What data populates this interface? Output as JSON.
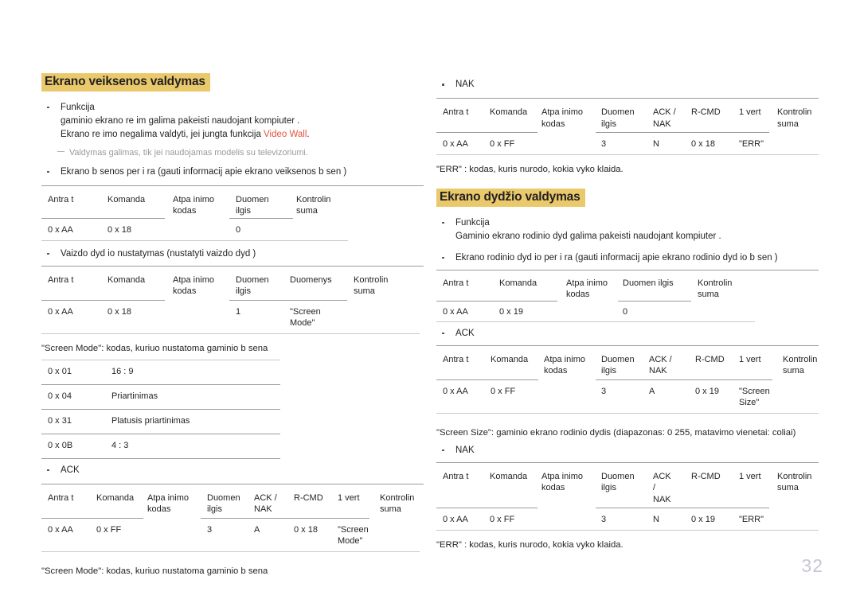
{
  "page": {
    "number": "32"
  },
  "left_column": {
    "heading": "Ekrano veiksenos valdymas",
    "function_bullet": "Funkcija",
    "function_line1": "gaminio ekrano re im  galima pakeisti naudojant kompiuter .",
    "function_line2_pre": "Ekrano re imo negalima valdyti, jei  jungta funkcija ",
    "function_line2_accent": "Video Wall",
    "function_line2_post": ".",
    "note": "Valdymas galimas, tik jei naudojamas modelis su televizoriumi.",
    "view_bullet": "Ekrano b senos per i ra (gauti informacij  apie ekrano veiksenos b sen )",
    "view_table": {
      "headers": [
        "Antra t",
        "Komanda",
        "Atpa inimo\nkodas",
        "Duomen\nilgis",
        "Kontrolin\nsuma"
      ],
      "row": [
        "0 x AA",
        "0 x 18",
        "",
        "0",
        ""
      ]
    },
    "set_bullet": "Vaizdo dyd io nustatymas (nustatyti vaizdo dyd )",
    "set_table": {
      "headers": [
        "Antra t",
        "Komanda",
        "Atpa inimo\nkodas",
        "Duomen\nilgis",
        "Duomenys",
        "Kontrolin\nsuma"
      ],
      "row": [
        "0 x AA",
        "0 x 18",
        "",
        "1",
        "\"Screen\nMode\"",
        ""
      ]
    },
    "codes_caption": "\"Screen Mode\": kodas, kuriuo nustatoma gaminio b sena",
    "codes": [
      {
        "code": "0 x 01",
        "name": "16 : 9"
      },
      {
        "code": "0 x 04",
        "name": "Priartinimas"
      },
      {
        "code": "0 x 31",
        "name": "Platusis priartinimas"
      },
      {
        "code": "0 x 0B",
        "name": "4 : 3"
      }
    ],
    "ack_bullet": "ACK",
    "ack_table": {
      "headers": [
        "Antra t",
        "Komanda",
        "Atpa inimo\nkodas",
        "Duomen\nilgis",
        "ACK /\nNAK",
        "R-CMD",
        "1 vert",
        "Kontrolin\nsuma"
      ],
      "row": [
        "0 x AA",
        "0 x FF",
        "",
        "3",
        "A",
        "0 x 18",
        "\"Screen\nMode\"",
        ""
      ]
    },
    "ack_caption": "\"Screen Mode\": kodas, kuriuo nustatoma gaminio b sena"
  },
  "right_column": {
    "nak_bullet_top": "NAK",
    "nak_table_top": {
      "headers": [
        "Antra t",
        "Komanda",
        "Atpa inimo\nkodas",
        "Duomen\nilgis",
        "ACK /\nNAK",
        "R-CMD",
        "1 vert",
        "Kontrolin\nsuma"
      ],
      "row": [
        "0 x AA",
        "0 x FF",
        "",
        "3",
        "N",
        "0 x 18",
        "\"ERR\"",
        ""
      ]
    },
    "err_caption_top": "\"ERR\" : kodas, kuris nurodo, kokia  vyko klaida.",
    "heading": "Ekrano dydžio valdymas",
    "function_bullet": "Funkcija",
    "function_line1": "Gaminio ekrano rodinio dyd  galima pakeisti naudojant kompiuter .",
    "view_bullet": "Ekrano rodinio dyd io per i ra (gauti informacij  apie ekrano rodinio dyd io b sen )",
    "view_table": {
      "headers": [
        "Antra t",
        "Komanda",
        "Atpa inimo\nkodas",
        "Duomen  ilgis",
        "Kontrolin\nsuma"
      ],
      "row": [
        "0 x AA",
        "0 x 19",
        "",
        "0",
        ""
      ]
    },
    "ack_bullet": "ACK",
    "ack_table": {
      "headers": [
        "Antra t",
        "Komanda",
        "Atpa inimo\nkodas",
        "Duomen\nilgis",
        "ACK /\nNAK",
        "R-CMD",
        "1 vert",
        "Kontrolin\nsuma"
      ],
      "row": [
        "0 x AA",
        "0 x FF",
        "",
        "3",
        "A",
        "0 x 19",
        "\"Screen\nSize\"",
        ""
      ]
    },
    "size_caption": "\"Screen Size\": gaminio ekrano rodinio dydis (diapazonas: 0 255, matavimo vienetai: coliai)",
    "nak_bullet_bottom": "NAK",
    "nak_table_bottom": {
      "headers": [
        "Antra t",
        "Komanda",
        "Atpa inimo\nkodas",
        "Duomen\nilgis",
        "ACK\n/\nNAK",
        "R-CMD",
        "1 vert",
        "Kontrolin\nsuma"
      ],
      "row": [
        "0 x AA",
        "0 x FF",
        "",
        "3",
        "N",
        "0 x 19",
        "\"ERR\"",
        ""
      ]
    },
    "err_caption_bottom": "\"ERR\" : kodas, kuris nurodo, kokia  vyko klaida."
  },
  "colors": {
    "heading_highlight": "#e9c96b",
    "accent_red": "#e4543a",
    "note_gray": "#9a9a9e",
    "page_number": "#c6c7d2",
    "rule": "#9b9b9f"
  }
}
